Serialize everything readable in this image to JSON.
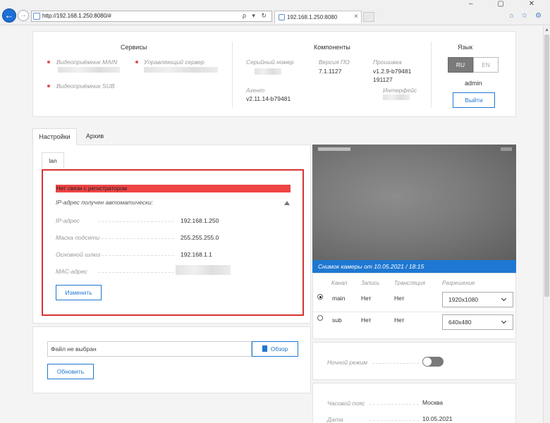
{
  "browser": {
    "url": "http://192.168.1.250:8080/#",
    "tab_title": "192.168.1.250:8080",
    "tab_close": "×",
    "window_controls": "– ▢ ✕",
    "right_icons": "⌂ ☆ ⚙",
    "addr_tools": "ρ ▾ ↻",
    "back": "←",
    "forward": "→"
  },
  "services": {
    "title": "Сервисы",
    "items": [
      "Видеоприёмник MAIN",
      "Управляющий сервер",
      "Видеоприёмник SUB"
    ]
  },
  "components": {
    "title": "Компоненты",
    "serial_label": "Серийный номер",
    "version_label": "Версия ПО",
    "version_value": "7.1.1127",
    "firmware_label": "Прошивка",
    "firmware_value_1": "v1.2.9-b79481",
    "firmware_value_2": "191127",
    "agent_label": "Агент",
    "agent_value": "v2.11.14-b79481",
    "interface_label": "Интерфейс"
  },
  "language": {
    "title": "Язык",
    "ru": "RU",
    "en": "EN",
    "user": "admin",
    "logout": "Выйти"
  },
  "tabs": {
    "settings": "Настройки",
    "archive": "Архив"
  },
  "lan": {
    "tab": "lan",
    "error": "Нет связи с регистратором",
    "auto_ip": "IP-адрес получен автоматически:",
    "ip_label": "IP-адрес",
    "ip_value": "192.168.1.250",
    "mask_label": "Маска подсети",
    "mask_value": "255.255.255.0",
    "gateway_label": "Основной шлюз",
    "gateway_value": "192.168.1.1",
    "mac_label": "MAC-адрес",
    "change_button": "Изменить"
  },
  "firmware_upload": {
    "file_placeholder": "Файл не выбран",
    "browse": "Обзор",
    "update": "Обновить"
  },
  "camera": {
    "caption": "Снимок камеры от 10.05.2021 / 18:15"
  },
  "channels": {
    "headers": [
      "Канал",
      "Запись",
      "Трансляция",
      "Разрешение"
    ],
    "rows": [
      {
        "name": "main",
        "record": "Нет",
        "stream": "Нет",
        "resolution": "1920x1080",
        "selected": true
      },
      {
        "name": "sub",
        "record": "Нет",
        "stream": "Нет",
        "resolution": "640x480",
        "selected": false
      }
    ]
  },
  "night_mode": {
    "label": "Ночной режим",
    "enabled": false
  },
  "time": {
    "tz_label": "Часовой пояс",
    "tz_value": "Москва",
    "date_label": "Дата",
    "date_value": "10.05.2021"
  },
  "colors": {
    "accent": "#1e78d2",
    "error": "#ef4444",
    "border_error": "#d63333"
  }
}
